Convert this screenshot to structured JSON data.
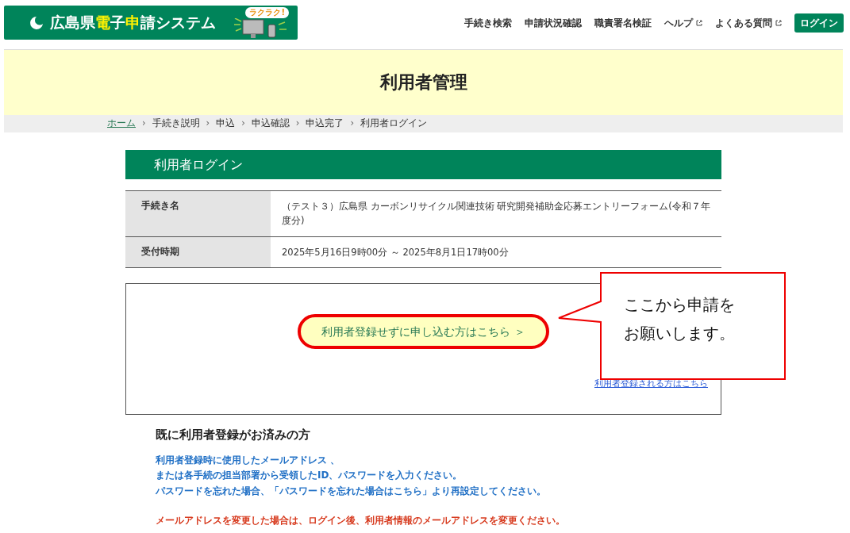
{
  "logo": {
    "segments": [
      {
        "text": "広島県",
        "highlight": false
      },
      {
        "text": "電",
        "highlight": true
      },
      {
        "text": "子",
        "highlight": false
      },
      {
        "text": "申",
        "highlight": true
      },
      {
        "text": "請システム",
        "highlight": false
      }
    ],
    "bubble": "ラクラク!"
  },
  "nav": [
    {
      "label": "手続き検索",
      "external": false
    },
    {
      "label": "申請状況確認",
      "external": false
    },
    {
      "label": "職責署名検証",
      "external": false
    },
    {
      "label": "ヘルプ",
      "external": true
    },
    {
      "label": "よくある質問",
      "external": true
    }
  ],
  "login_button": "ログイン",
  "page_title": "利用者管理",
  "breadcrumb_separator": "›",
  "breadcrumb": [
    {
      "label": "ホーム",
      "link": true
    },
    {
      "label": "手続き説明",
      "link": false
    },
    {
      "label": "申込",
      "link": false
    },
    {
      "label": "申込確認",
      "link": false
    },
    {
      "label": "申込完了",
      "link": false
    },
    {
      "label": "利用者ログイン",
      "link": false
    }
  ],
  "section_title": "利用者ログイン",
  "info_table": [
    {
      "label": "手続き名",
      "value": "（テスト３）広島県 カーボンリサイクル関連技術 研究開発補助金応募エントリーフォーム(令和７年度分)"
    },
    {
      "label": "受付時期",
      "value": "2025年5月16日9時00分 ～ 2025年8月1日17時00分"
    }
  ],
  "guest_link": "利用者登録せずに申し込む方はこちら ＞",
  "register_link": "利用者登録される方はこちら",
  "callout": {
    "lines": [
      "ここから申請を",
      "お願いします。"
    ]
  },
  "registered": {
    "heading": "既に利用者登録がお済みの方",
    "notes": [
      "利用者登録時に使用したメールアドレス 、",
      "または各手続の担当部署から受領したID、パスワードを入力ください。",
      "パスワードを忘れた場合、「パスワードを忘れた場合はこちら」より再設定してください。"
    ],
    "warning": "メールアドレスを変更した場合は、ログイン後、利用者情報のメールアドレスを変更ください。"
  }
}
